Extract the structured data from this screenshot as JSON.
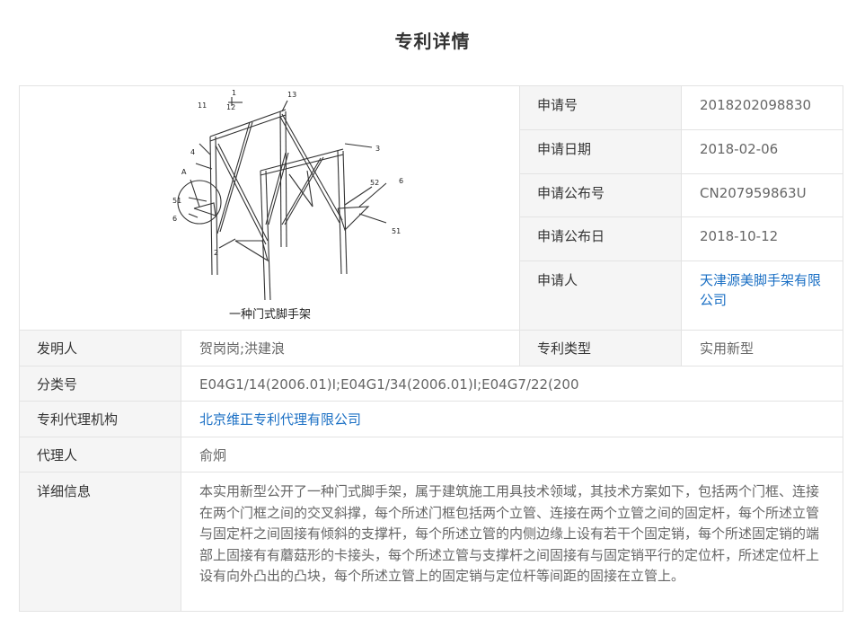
{
  "page": {
    "title": "专利详情"
  },
  "figure": {
    "caption": "一种门式脚手架",
    "callouts": [
      "1",
      "11",
      "12",
      "13",
      "4",
      "3",
      "A",
      "52",
      "6",
      "51",
      "6",
      "51",
      "2"
    ]
  },
  "right_fields": [
    {
      "label": "申请号",
      "value": "2018202098830"
    },
    {
      "label": "申请日期",
      "value": "2018-02-06"
    },
    {
      "label": "申请公布号",
      "value": "CN207959863U"
    },
    {
      "label": "申请公布日",
      "value": "2018-10-12"
    },
    {
      "label": "申请人",
      "value": "天津源美脚手架有限公司"
    }
  ],
  "inventor": {
    "label": "发明人",
    "value": "贺岗岗;洪建浪"
  },
  "patent_type": {
    "label": "专利类型",
    "value": "实用新型"
  },
  "classification": {
    "label": "分类号",
    "value": "E04G1/14(2006.01)I;E04G1/34(2006.01)I;E04G7/22(200"
  },
  "agency": {
    "label": "专利代理机构",
    "value": "北京维正专利代理有限公司"
  },
  "agent": {
    "label": "代理人",
    "value": "俞炯"
  },
  "details": {
    "label": "详细信息",
    "value": "本实用新型公开了一种门式脚手架，属于建筑施工用具技术领域，其技术方案如下，包括两个门框、连接在两个门框之间的交叉斜撑，每个所述门框包括两个立管、连接在两个立管之间的固定杆，每个所述立管与固定杆之间固接有倾斜的支撑杆，每个所述立管的内侧边缘上设有若干个固定销，每个所述固定销的端部上固接有有蘑菇形的卡接头，每个所述立管与支撑杆之间固接有与固定销平行的定位杆，所述定位杆上设有向外凸出的凸块，每个所述立管上的固定销与定位杆等间距的固接在立管上。"
  },
  "colors": {
    "link": "#1a6fc4",
    "label_bg": "#f5f5f5",
    "border": "#e3e3e3"
  }
}
